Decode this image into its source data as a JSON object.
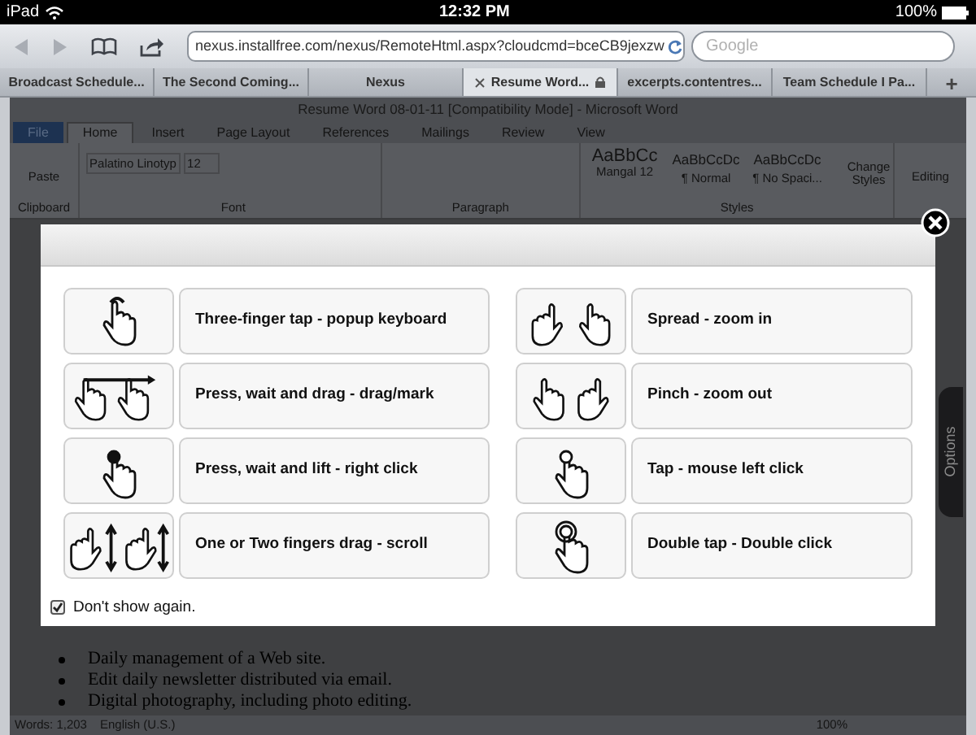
{
  "status_bar": {
    "device": "iPad",
    "time": "12:32 PM",
    "battery": "100%"
  },
  "browser": {
    "url": "nexus.installfree.com/nexus/RemoteHtml.aspx?cloudcmd=bceCB9jexzw",
    "search_placeholder": "Google",
    "tabs": [
      {
        "label": "Broadcast Schedule...",
        "selected": false
      },
      {
        "label": "The Second Coming...",
        "selected": false
      },
      {
        "label": "Nexus",
        "selected": false
      },
      {
        "label": "Resume Word...",
        "selected": true
      },
      {
        "label": "excerpts.contentres...",
        "selected": false
      },
      {
        "label": "Team Schedule I Pa...",
        "selected": false
      }
    ],
    "new_tab": "+"
  },
  "word": {
    "title": "Resume Word 08-01-11 [Compatibility Mode] - Microsoft Word",
    "ribbon_tabs": [
      {
        "label": "File",
        "selected": false
      },
      {
        "label": "Home",
        "selected": true
      },
      {
        "label": "Insert",
        "selected": false
      },
      {
        "label": "Page Layout",
        "selected": false
      },
      {
        "label": "References",
        "selected": false
      },
      {
        "label": "Mailings",
        "selected": false
      },
      {
        "label": "Review",
        "selected": false
      },
      {
        "label": "View",
        "selected": false
      }
    ],
    "paste": "Paste",
    "font_name": "Palatino Linotyp",
    "font_size": "12",
    "groups": [
      "Clipboard",
      "Font",
      "Paragraph",
      "Styles"
    ],
    "styles": [
      {
        "sample": "AaBbCc",
        "name": "Mangal 12"
      },
      {
        "sample": "AaBbCcDc",
        "name": "¶ Normal"
      },
      {
        "sample": "AaBbCcDc",
        "name": "¶ No Spaci..."
      }
    ],
    "change_styles": "Change Styles",
    "editing": "Editing",
    "bullets": [
      "Daily management of a Web site.",
      "Edit daily newsletter distributed via email.",
      "Digital photography, including photo editing."
    ],
    "words": "Words: 1,203",
    "language": "English (U.S.)",
    "zoom": "100%"
  },
  "options_tab": "Options",
  "dialog": {
    "gestures_left": [
      {
        "kind": "three-finger-tap",
        "label": "Three-finger tap - popup keyboard"
      },
      {
        "kind": "drag",
        "label": "Press, wait and drag - drag/mark"
      },
      {
        "kind": "press-lift",
        "label": "Press, wait and lift - right click"
      },
      {
        "kind": "scroll",
        "label": "One or Two fingers drag - scroll"
      }
    ],
    "gestures_right": [
      {
        "kind": "spread",
        "label": "Spread - zoom in"
      },
      {
        "kind": "pinch",
        "label": "Pinch - zoom out"
      },
      {
        "kind": "tap",
        "label": "Tap - mouse left click"
      },
      {
        "kind": "double-tap",
        "label": "Double tap - Double click"
      }
    ],
    "dont_show": {
      "label": "Don't show again.",
      "checked": true
    }
  }
}
